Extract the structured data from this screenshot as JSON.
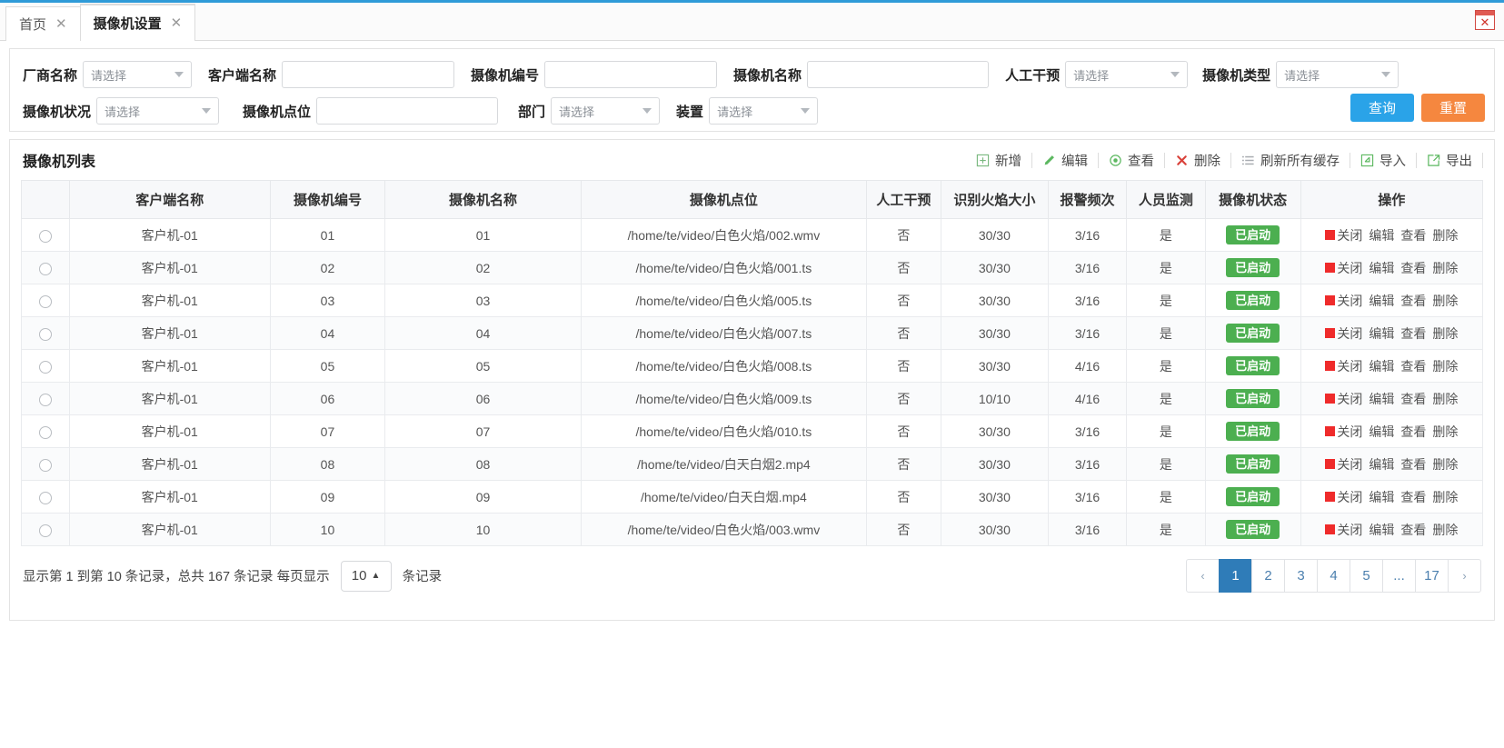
{
  "window": {
    "close_label": "✕"
  },
  "tabs": [
    {
      "label": "首页",
      "close": "✕",
      "active": false
    },
    {
      "label": "摄像机设置",
      "close": "✕",
      "active": true
    }
  ],
  "filters": {
    "placeholder_select": "请选择",
    "row1": [
      {
        "label": "厂商名称",
        "type": "select",
        "value": "请选择"
      },
      {
        "label": "客户端名称",
        "type": "text",
        "value": ""
      },
      {
        "label": "摄像机编号",
        "type": "text",
        "value": ""
      },
      {
        "label": "摄像机名称",
        "type": "text",
        "value": ""
      },
      {
        "label": "人工干预",
        "type": "select",
        "value": "请选择"
      },
      {
        "label": "摄像机类型",
        "type": "select",
        "value": "请选择"
      }
    ],
    "row2": [
      {
        "label": "摄像机状况",
        "type": "select",
        "value": "请选择"
      },
      {
        "label": "摄像机点位",
        "type": "text",
        "value": ""
      },
      {
        "label": "部门",
        "type": "select",
        "value": "请选择"
      },
      {
        "label": "装置",
        "type": "select",
        "value": "请选择"
      }
    ],
    "search_label": "查询",
    "reset_label": "重置"
  },
  "list": {
    "title": "摄像机列表",
    "toolbar": [
      {
        "icon": "add-icon",
        "label": "新增"
      },
      {
        "icon": "edit-pencil-icon",
        "label": "编辑"
      },
      {
        "icon": "eye-icon",
        "label": "查看"
      },
      {
        "icon": "delete-cross-icon",
        "label": "删除"
      },
      {
        "icon": "refresh-list-icon",
        "label": "刷新所有缓存"
      },
      {
        "icon": "import-icon",
        "label": "导入"
      },
      {
        "icon": "export-icon",
        "label": "导出"
      }
    ],
    "columns": [
      "",
      "客户端名称",
      "摄像机编号",
      "摄像机名称",
      "摄像机点位",
      "人工干预",
      "识别火焰大小",
      "报警频次",
      "人员监测",
      "摄像机状态",
      "操作"
    ],
    "ops_labels": {
      "close": "关闭",
      "edit": "编辑",
      "view": "查看",
      "delete": "删除"
    },
    "rows": [
      {
        "client": "客户机-01",
        "code": "01",
        "name": "01",
        "point": "/home/te/video/白色火焰/002.wmv",
        "manual": "否",
        "flame": "30/30",
        "alarm": "3/16",
        "person": "是",
        "status": "已启动"
      },
      {
        "client": "客户机-01",
        "code": "02",
        "name": "02",
        "point": "/home/te/video/白色火焰/001.ts",
        "manual": "否",
        "flame": "30/30",
        "alarm": "3/16",
        "person": "是",
        "status": "已启动"
      },
      {
        "client": "客户机-01",
        "code": "03",
        "name": "03",
        "point": "/home/te/video/白色火焰/005.ts",
        "manual": "否",
        "flame": "30/30",
        "alarm": "3/16",
        "person": "是",
        "status": "已启动"
      },
      {
        "client": "客户机-01",
        "code": "04",
        "name": "04",
        "point": "/home/te/video/白色火焰/007.ts",
        "manual": "否",
        "flame": "30/30",
        "alarm": "3/16",
        "person": "是",
        "status": "已启动"
      },
      {
        "client": "客户机-01",
        "code": "05",
        "name": "05",
        "point": "/home/te/video/白色火焰/008.ts",
        "manual": "否",
        "flame": "30/30",
        "alarm": "4/16",
        "person": "是",
        "status": "已启动"
      },
      {
        "client": "客户机-01",
        "code": "06",
        "name": "06",
        "point": "/home/te/video/白色火焰/009.ts",
        "manual": "否",
        "flame": "10/10",
        "alarm": "4/16",
        "person": "是",
        "status": "已启动"
      },
      {
        "client": "客户机-01",
        "code": "07",
        "name": "07",
        "point": "/home/te/video/白色火焰/010.ts",
        "manual": "否",
        "flame": "30/30",
        "alarm": "3/16",
        "person": "是",
        "status": "已启动"
      },
      {
        "client": "客户机-01",
        "code": "08",
        "name": "08",
        "point": "/home/te/video/白天白烟2.mp4",
        "manual": "否",
        "flame": "30/30",
        "alarm": "3/16",
        "person": "是",
        "status": "已启动"
      },
      {
        "client": "客户机-01",
        "code": "09",
        "name": "09",
        "point": "/home/te/video/白天白烟.mp4",
        "manual": "否",
        "flame": "30/30",
        "alarm": "3/16",
        "person": "是",
        "status": "已启动"
      },
      {
        "client": "客户机-01",
        "code": "10",
        "name": "10",
        "point": "/home/te/video/白色火焰/003.wmv",
        "manual": "否",
        "flame": "30/30",
        "alarm": "3/16",
        "person": "是",
        "status": "已启动"
      }
    ]
  },
  "footer": {
    "summary_prefix": "显示第 1 到第 10 条记录，总共 167 条记录 每页显示",
    "page_size": "10",
    "page_size_caret": "▲",
    "summary_suffix": "条记录",
    "pages": [
      "‹",
      "1",
      "2",
      "3",
      "4",
      "5",
      "...",
      "17",
      "›"
    ],
    "active_page": "1"
  },
  "colors": {
    "accent": "#2f9bd8",
    "primary_button": "#2aa3e8",
    "reset_button": "#f5873f",
    "status_green": "#4caf50",
    "close_red": "#ef2b2b"
  }
}
